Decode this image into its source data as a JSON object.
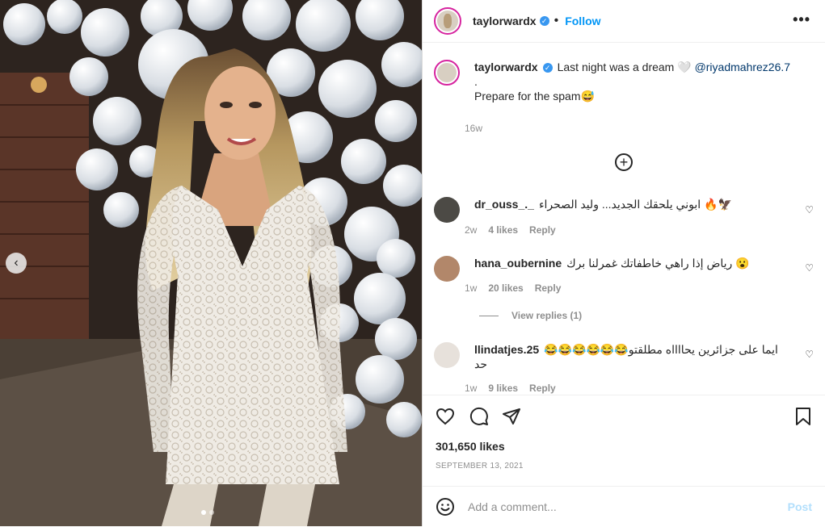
{
  "header": {
    "username": "taylorwardx",
    "follow_label": "Follow",
    "more_label": "•••"
  },
  "caption": {
    "username": "taylorwardx",
    "text": "Last night was a dream 🤍 ",
    "mention": "@riyadmahrez26.7",
    "dot": ".",
    "line2": "Prepare for the spam😅",
    "time": "16w"
  },
  "comments": [
    {
      "username": "dr_ouss_._",
      "text": "ابوني يلحقك الجديد... وليد الصحراء 🔥🦅",
      "time": "2w",
      "likes": "4 likes",
      "reply": "Reply"
    },
    {
      "username": "hana_oubernine",
      "text": "رياض إذا راهي خاطفاتك غمرلنا برك 😮",
      "time": "1w",
      "likes": "20 likes",
      "reply": "Reply",
      "view_replies": "View replies (1)"
    },
    {
      "username": "llindatjes.25",
      "text": "ايما على جزائرين يحااااه مطلقتو😂😂😂😂😂😂 حد",
      "time": "1w",
      "likes": "9 likes",
      "reply": "Reply"
    }
  ],
  "icons": {
    "heart": "heart-icon",
    "comment": "comment-icon",
    "share": "share-icon",
    "save": "bookmark-icon",
    "emoji": "emoji-icon",
    "plus": "plus-circle-icon",
    "prev": "chevron-left-icon"
  },
  "likes_count": "301,650 likes",
  "date": "SEPTEMBER 13, 2021",
  "add_comment": {
    "placeholder": "Add a comment...",
    "post_label": "Post"
  },
  "carousel": {
    "total": 2,
    "current": 1
  },
  "colors": {
    "link_blue": "#0095f6",
    "mention": "#00376b",
    "muted": "#8e8e8e",
    "post_disabled": "#b2dffc"
  }
}
